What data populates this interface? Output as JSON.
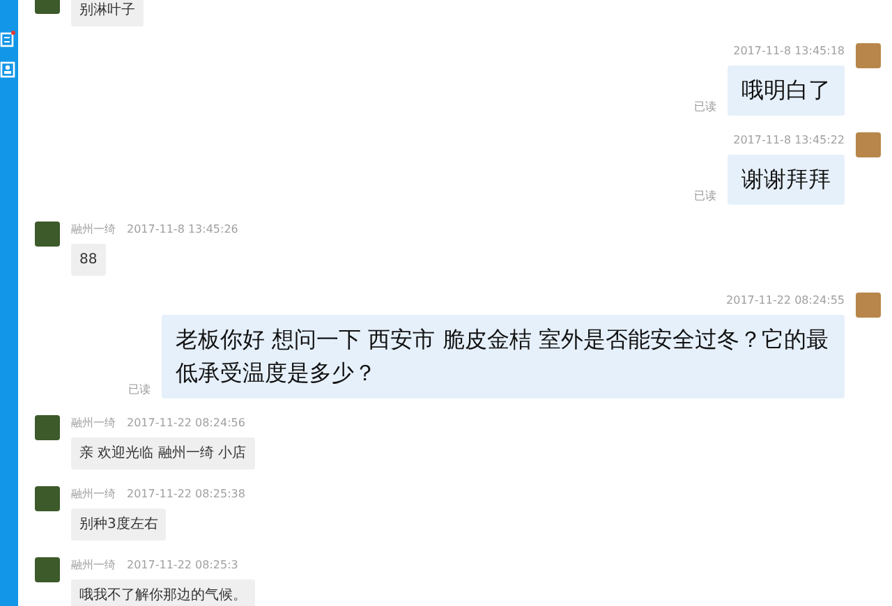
{
  "sidebar": {
    "items": [
      {
        "kind": "chat",
        "badge": true
      },
      {
        "kind": "contacts",
        "badge": false
      }
    ]
  },
  "messages": [
    {
      "kind": "incoming",
      "text": "别淋叶子"
    },
    {
      "kind": "outgoing",
      "time": "2017-11-8 13:45:18",
      "text": "哦明白了",
      "read": "已读"
    },
    {
      "kind": "outgoing",
      "time": "2017-11-8 13:45:22",
      "text": "谢谢拜拜",
      "read": "已读"
    },
    {
      "kind": "incoming",
      "name": "融州一绮",
      "time": "2017-11-8 13:45:26",
      "text": "88"
    },
    {
      "kind": "outgoing",
      "time": "2017-11-22 08:24:55",
      "text": "老板你好 想问一下 西安市 脆皮金桔 室外是否能安全过冬？它的最低承受温度是多少？",
      "read": "已读"
    },
    {
      "kind": "incoming",
      "name": "融州一绮",
      "time": "2017-11-22 08:24:56",
      "text": "亲 欢迎光临 融州一绮 小店"
    },
    {
      "kind": "incoming",
      "name": "融州一绮",
      "time": "2017-11-22 08:25:38",
      "text": "别种3度左右"
    },
    {
      "kind": "incoming",
      "name": "融州一绮",
      "time": "2017-11-22 08:25:3",
      "text": "哦我不了解你那边的气候。"
    }
  ]
}
